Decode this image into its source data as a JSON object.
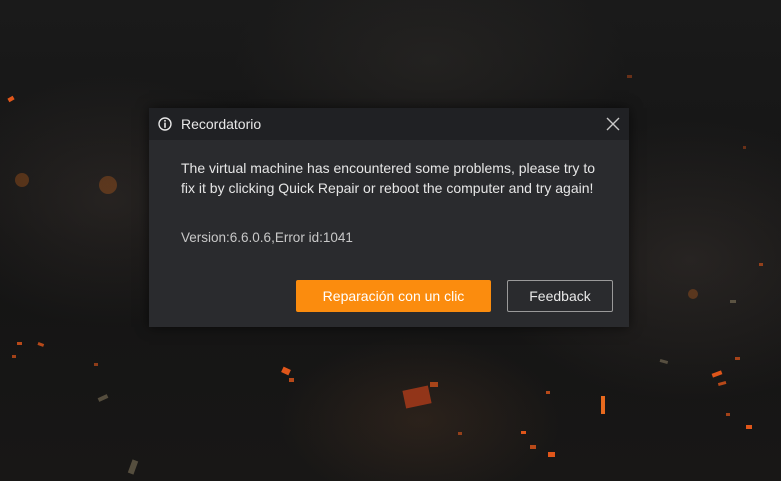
{
  "dialog": {
    "title": "Recordatorio",
    "title_icon": "info-icon",
    "close_icon": "close-icon",
    "message": "The virtual machine has encountered some problems, please try to fix it by clicking Quick Repair or reboot the computer and try again!",
    "version_text": "Version:6.6.0.6,Error id:1041",
    "primary_button_label": "Reparación con un clic",
    "secondary_button_label": "Feedback"
  },
  "colors": {
    "accent": "#fb8c0e",
    "dialog_background": "#2a2b2e",
    "titlebar_background": "#202124",
    "text": "#e6e6e6"
  }
}
